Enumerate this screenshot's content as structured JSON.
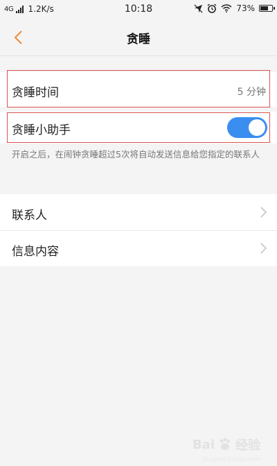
{
  "status_bar": {
    "network": "4G",
    "speed": "1.2K/s",
    "time": "10:18",
    "battery": "73%",
    "battery_level": 0.73
  },
  "nav": {
    "title": "贪睡"
  },
  "snooze_time": {
    "label": "贪睡时间",
    "value": "5 分钟"
  },
  "snooze_assistant": {
    "label": "贪睡小助手",
    "enabled": true,
    "description": "开启之后，在闹钟贪睡超过5次将自动发送信息给您指定的联系人"
  },
  "list": [
    {
      "label": "联系人"
    },
    {
      "label": "信息内容"
    }
  ],
  "watermark": {
    "brand": "Bai",
    "brand_cn": "经验",
    "url": "jingyan.baidu.com"
  },
  "colors": {
    "accent": "#3a8ef0",
    "back_arrow": "#f08a3a",
    "highlight": "#d9534f"
  }
}
